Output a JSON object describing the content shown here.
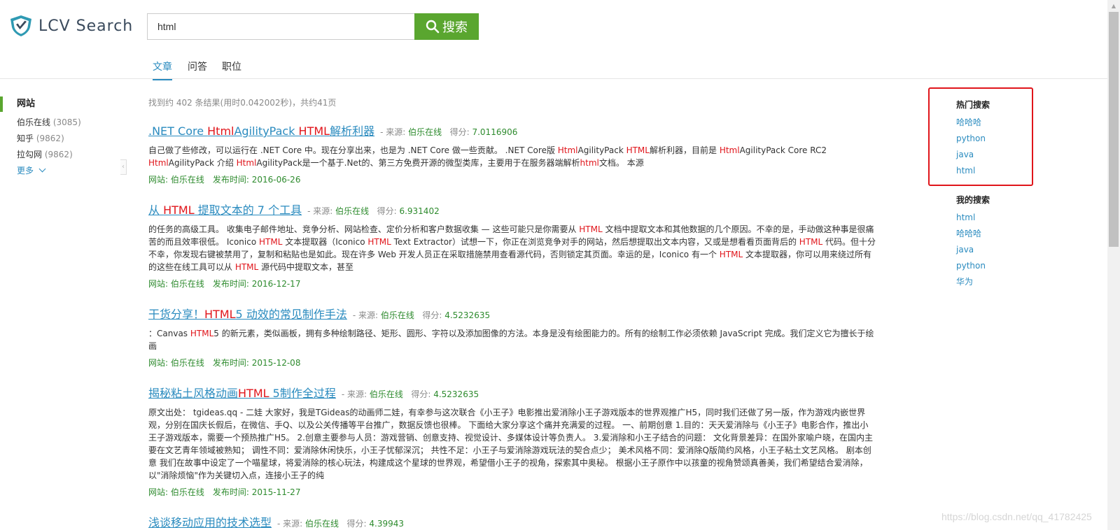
{
  "header": {
    "logo_text": "LCV Search",
    "search_value": "html",
    "search_button_label": "搜索"
  },
  "tabs": [
    {
      "label": "文章",
      "active": true
    },
    {
      "label": "问答",
      "active": false
    },
    {
      "label": "职位",
      "active": false
    }
  ],
  "sidebar": {
    "heading": "网站",
    "items": [
      {
        "label": "伯乐在线",
        "count": "(3085)"
      },
      {
        "label": "知乎",
        "count": "(9862)"
      },
      {
        "label": "拉勾网",
        "count": "(9862)"
      }
    ],
    "more_label": "更多"
  },
  "summary": "找到约 402 条结果(用时0.042002秒)，共约41页",
  "results": [
    {
      "title": ".NET Core HtmlAgilityPack HTML解析利器",
      "source_label": "来源:",
      "source": "伯乐在线",
      "score_label": "得分:",
      "score": "7.0116906",
      "snippet": "自己做了些修改，可以运行在 .NET Core 中。现在分享出来，也是为 .NET Core 做一些贡献。 .NET Core版 HtmlAgilityPack HTML解析利器，目前是 HtmlAgilityPack Core RC2 HtmlAgilityPack 介绍 HtmlAgilityPack是一个基于.Net的、第三方免费开源的微型类库，主要用于在服务器端解析html文档。 本源",
      "site": "网站: 伯乐在线",
      "date": "发布时间: 2016-06-26"
    },
    {
      "title": "从 HTML 提取文本的 7 个工具",
      "source_label": "来源:",
      "source": "伯乐在线",
      "score_label": "得分:",
      "score": "6.931402",
      "snippet": "的任务的高级工具。 收集电子邮件地址、竞争分析、网站检查、定价分析和客户数据收集 — 这些可能只是你需要从 HTML 文档中提取文本和其他数据的几个原因。不幸的是，手动做这种事是很痛苦的而且效率很低。 Iconico HTML 文本提取器（Iconico HTML Text Extractor）试想一下，你正在浏览竞争对手的网站，然后想提取出文本内容，又或是想看看页面背后的 HTML 代码。但十分不幸，你发现右键被禁用了，复制和粘贴也是如此。现在许多 Web 开发人员正在采取措施禁用查看源代码，否则锁定其页面。幸运的是，Iconico 有一个 HTML 文本提取器，你可以用来绕过所有的这些在线工具可以从 HTML 源代码中提取文本，甚至",
      "site": "网站: 伯乐在线",
      "date": "发布时间: 2016-12-17"
    },
    {
      "title": "干货分享！HTML5 动效的常见制作手法",
      "source_label": "来源:",
      "source": "伯乐在线",
      "score_label": "得分:",
      "score": "4.5232635",
      "snippet": "：Canvas HTML5 的新元素，类似画板，拥有多种绘制路径、矩形、圆形、字符以及添加图像的方法。本身是没有绘图能力的。所有的绘制工作必须依赖 JavaScript 完成。我们定义它为擅长于绘画",
      "site": "网站: 伯乐在线",
      "date": "发布时间: 2015-12-08"
    },
    {
      "title": "揭秘粘土风格动画HTML 5制作全过程",
      "source_label": "来源:",
      "source": "伯乐在线",
      "score_label": "得分:",
      "score": "4.5232635",
      "snippet": "原文出处： tgideas.qq - 二娃 大家好，我是TGideas的动画师二娃，有幸参与这次联合《小王子》电影推出爱消除小王子游戏版本的世界观推广H5，同时我们还做了另一版，作为游戏内嵌世界观，分别在国庆长假后，在微信、手Q、以及公关传播等平台推广，数据反馈也很棒。 下面给大家分享这个痛并充满爱的过程。 一、前期创意 1.目的：天天爱消除与《小王子》电影合作，推出小王子游戏版本，需要一个预热推广H5。 2.创意主要参与人员：游戏营销、创意支持、视觉设计、多媒体设计等负责人。 3.爱消除和小王子结合的问题： 文化背景差异：在国外家喻户晓，在国内主要在文艺青年领域被熟知； 调性不同：爱消除休闲快乐，小王子忧郁深沉； 共性不足：小王子与爱消除游戏玩法的契合点少； 美术风格不同：爱消除Q版简约风格，小王子粘土文艺风格。 剧本创意 我们在故事中设定了一个喵星球，将爱消除的核心玩法，构建成这个星球的世界观，希望借小王子的视角，探索其中奥秘。 根据小王子原作中以孩童的视角赞颂真善美，我们希望结合爱消除，以\"消除烦恼\"作为关键切入点，连接小王子的纯",
      "site": "网站: 伯乐在线",
      "date": "发布时间: 2015-11-27"
    },
    {
      "title": "浅谈移动应用的技术选型",
      "source_label": "来源:",
      "source": "伯乐在线",
      "score_label": "得分:",
      "score": "4.39943",
      "snippet": "",
      "site": "",
      "date": ""
    }
  ],
  "right": {
    "hot_title": "热门搜索",
    "hot_items": [
      "哈哈哈",
      "python",
      "java",
      "html"
    ],
    "mine_title": "我的搜索",
    "mine_items": [
      "html",
      "哈哈哈",
      "java",
      "python",
      "华为"
    ]
  },
  "watermark": "https://blog.csdn.net/qq_41782425",
  "colors": {
    "accent_green": "#5aa62f",
    "link_blue": "#2a8bbf",
    "highlight_red": "#e0151b",
    "meta_green": "#2e8b2e"
  }
}
